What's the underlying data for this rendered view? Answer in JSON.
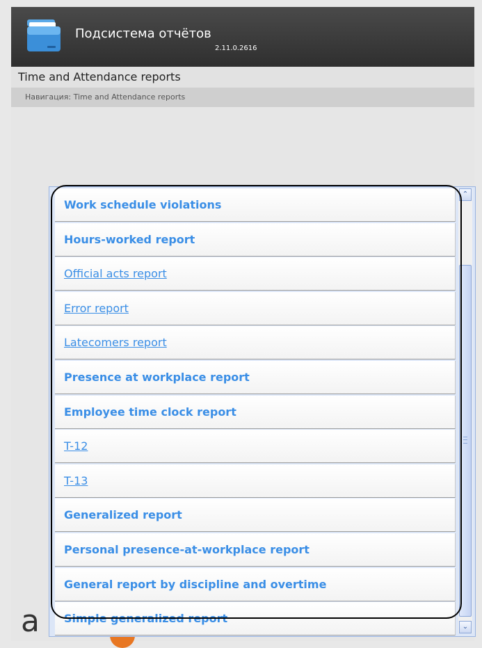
{
  "app": {
    "title": "Подсистема отчётов",
    "version": "2.11.0.2616",
    "icon": "folder-icon"
  },
  "page": {
    "title": "Time and Attendance reports",
    "breadcrumb": "Навигация: Time and Attendance reports"
  },
  "reports": [
    {
      "label": "Work schedule violations",
      "style": "bold"
    },
    {
      "label": "Hours-worked report",
      "style": "bold"
    },
    {
      "label": "Official acts report",
      "style": "link"
    },
    {
      "label": "Error report",
      "style": "link"
    },
    {
      "label": "Latecomers report",
      "style": "link"
    },
    {
      "label": "Presence at workplace report",
      "style": "bold"
    },
    {
      "label": "Employee time clock report",
      "style": "bold"
    },
    {
      "label": "T-12",
      "style": "link"
    },
    {
      "label": "T-13",
      "style": "link"
    },
    {
      "label": "Generalized report",
      "style": "bold"
    },
    {
      "label": "Personal presence-at-workplace report",
      "style": "bold"
    },
    {
      "label": "General report by discipline and overtime",
      "style": "bold"
    },
    {
      "label": "Simple generalized report",
      "style": "bold"
    }
  ],
  "scrollbar": {
    "up_icon": "chevron-up-icon",
    "down_icon": "chevron-down-icon",
    "up_glyph": "⌃",
    "down_glyph": "⌄"
  },
  "logo": {
    "text": "a",
    "accent_color": "#e87722"
  },
  "colors": {
    "link": "#3a8ee6",
    "header": "#3a3a3a"
  }
}
